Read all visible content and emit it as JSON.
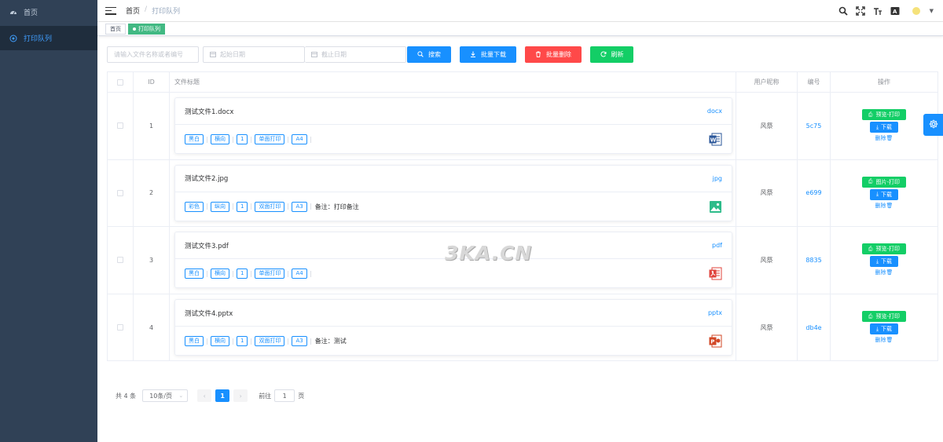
{
  "sidebar": {
    "items": [
      {
        "label": "首页"
      },
      {
        "label": "打印队列"
      }
    ]
  },
  "navbar": {
    "breadcrumb": [
      "首页",
      "打印队列"
    ],
    "breadcrumb_sep": "/",
    "font_size_icon_text": "T",
    "lang_icon_text": "A"
  },
  "tagsview": {
    "tags": [
      {
        "label": "首页"
      },
      {
        "label": "打印队列"
      }
    ]
  },
  "toolbar": {
    "search_placeholder": "请输入文件名称或者编号",
    "start_date_placeholder": "起始日期",
    "end_date_placeholder": "截止日期",
    "search_label": "搜索",
    "batch_download_label": "批量下载",
    "batch_delete_label": "批量删除",
    "refresh_label": "刷新"
  },
  "table": {
    "headers": {
      "id": "ID",
      "title": "文件标题",
      "user": "用户昵称",
      "no": "编号",
      "op": "操作"
    },
    "rows": [
      {
        "id": "1",
        "title": "测试文件1.docx",
        "ext": "docx",
        "tags": [
          "黑白",
          "横向",
          "1",
          "单面打印",
          "A4"
        ],
        "remark": "",
        "user": "风祭",
        "no": "5c75",
        "print_label": "预览-打印",
        "download_label": "下载",
        "delete_label": "删除",
        "file_icon": "word-icon"
      },
      {
        "id": "2",
        "title": "测试文件2.jpg",
        "ext": "jpg",
        "tags": [
          "彩色",
          "纵向",
          "1",
          "双面打印",
          "A3"
        ],
        "remark": "备注：打印备注",
        "user": "风祭",
        "no": "e699",
        "print_label": "图片-打印",
        "download_label": "下载",
        "delete_label": "删除",
        "file_icon": "image-icon"
      },
      {
        "id": "3",
        "title": "测试文件3.pdf",
        "ext": "pdf",
        "tags": [
          "黑白",
          "横向",
          "1",
          "单面打印",
          "A4"
        ],
        "remark": "",
        "user": "风祭",
        "no": "8835",
        "print_label": "预览-打印",
        "download_label": "下载",
        "delete_label": "删除",
        "file_icon": "pdf-icon"
      },
      {
        "id": "4",
        "title": "测试文件4.pptx",
        "ext": "pptx",
        "tags": [
          "黑白",
          "横向",
          "1",
          "双面打印",
          "A3"
        ],
        "remark": "备注：测试",
        "user": "风祭",
        "no": "db4e",
        "print_label": "预览-打印",
        "download_label": "下载",
        "delete_label": "删除",
        "file_icon": "ppt-icon"
      }
    ]
  },
  "pagination": {
    "total_text": "共 4 条",
    "page_size": "10条/页",
    "current_page": "1",
    "goto_prefix": "前往",
    "goto_value": "1",
    "goto_suffix": "页"
  },
  "watermark": "3KA.CN",
  "colors": {
    "sidebar_bg": "#304156",
    "primary": "#1890ff",
    "danger": "#ff4949",
    "success": "#13ce66",
    "tag_active": "#42b983"
  }
}
